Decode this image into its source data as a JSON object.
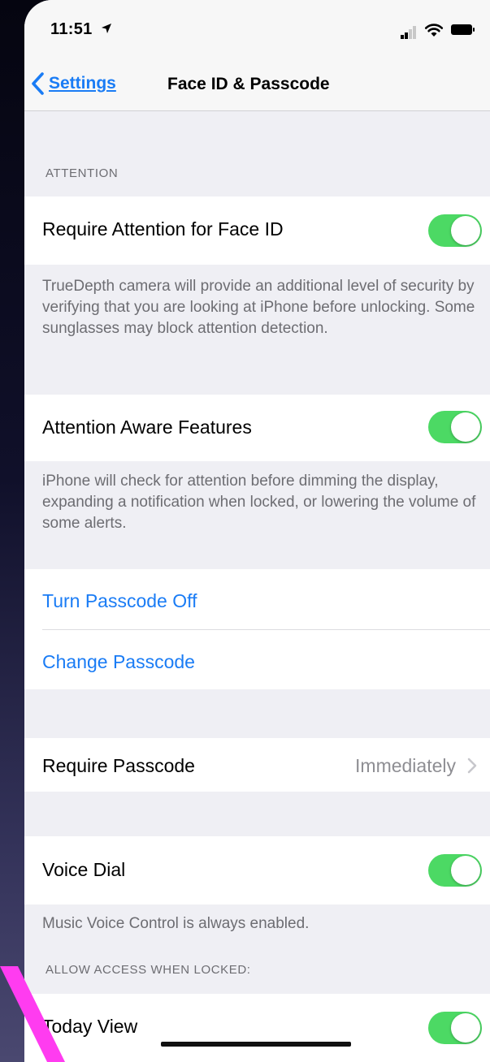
{
  "status_bar": {
    "time": "11:51"
  },
  "nav": {
    "back_label": "Settings",
    "title": "Face ID & Passcode"
  },
  "attention": {
    "header": "ATTENTION",
    "require_attention_label": "Require Attention for Face ID",
    "require_attention_on": true,
    "require_attention_footer": "TrueDepth camera will provide an additional level of security by verifying that you are looking at iPhone before unlocking. Some sunglasses may block attention detection.",
    "aware_label": "Attention Aware Features",
    "aware_on": true,
    "aware_footer": "iPhone will check for attention before dimming the display, expanding a notification when locked, or lowering the volume of some alerts."
  },
  "passcode": {
    "turn_off_label": "Turn Passcode Off",
    "change_label": "Change Passcode",
    "require_label": "Require Passcode",
    "require_value": "Immediately"
  },
  "voice_dial": {
    "label": "Voice Dial",
    "on": true,
    "footer": "Music Voice Control is always enabled."
  },
  "locked_access": {
    "header": "ALLOW ACCESS WHEN LOCKED:",
    "today_view_label": "Today View",
    "today_view_on": true
  },
  "colors": {
    "accent": "#1a7cf5",
    "toggle_on": "#4cd964",
    "annotation": "#ff3cf0"
  },
  "icons": {
    "location": "location-arrow-icon",
    "signal": "cellular-signal-icon",
    "wifi": "wifi-icon",
    "battery": "battery-icon",
    "back": "chevron-left-icon",
    "disclosure": "chevron-right-icon"
  }
}
